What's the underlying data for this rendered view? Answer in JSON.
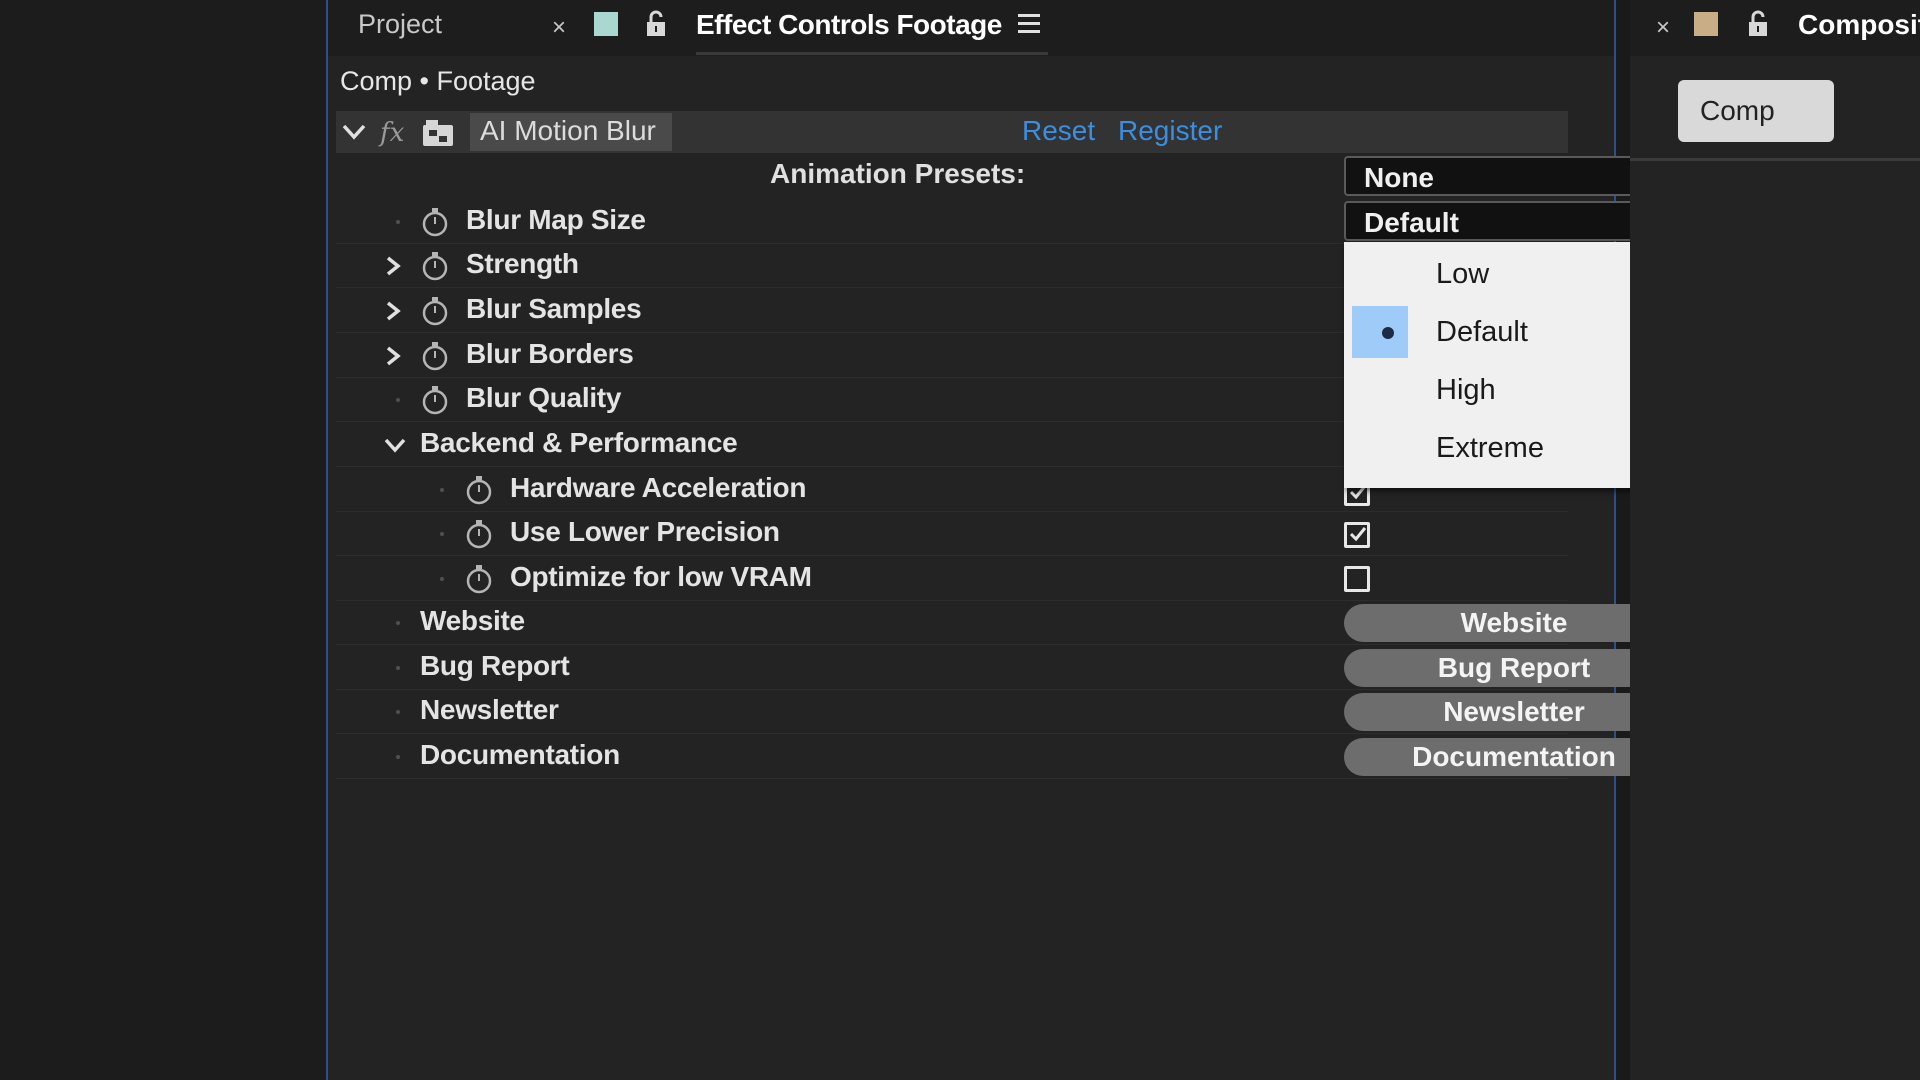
{
  "tabs": {
    "project": "Project",
    "close_symbol": "×",
    "effect_controls": "Effect Controls Footage",
    "right_title": "Composit"
  },
  "breadcrumb": "Comp • Footage",
  "effect": {
    "name": "AI Motion Blur",
    "reset": "Reset",
    "register": "Register",
    "presets_label": "Animation Presets:",
    "presets_value": "None"
  },
  "params": {
    "blur_map_size": "Blur Map Size",
    "blur_map_size_value": "Default",
    "strength": "Strength",
    "blur_samples": "Blur Samples",
    "blur_borders": "Blur Borders",
    "blur_quality": "Blur Quality",
    "backend": "Backend & Performance",
    "hardware_accel": "Hardware Acceleration",
    "lower_precision": "Use Lower Precision",
    "low_vram": "Optimize for low VRAM",
    "website": "Website",
    "bug_report": "Bug Report",
    "newsletter": "Newsletter",
    "documentation": "Documentation"
  },
  "buttons": {
    "website": "Website",
    "bug_report": "Bug Report",
    "newsletter": "Newsletter",
    "documentation": "Documentation"
  },
  "menu": {
    "items": [
      "Low",
      "Default",
      "High",
      "Extreme"
    ],
    "selected": "Default"
  },
  "checks": {
    "hardware_accel": true,
    "lower_precision": true,
    "low_vram": false
  },
  "right_panel": {
    "comp_button": "Comp"
  },
  "colors": {
    "link": "#3b8ee0",
    "panel_border": "#2e4f8a",
    "menu_selection": "#9ecbf7"
  },
  "icons": [
    "close-icon",
    "lock-icon",
    "hamburger-icon",
    "stopwatch-icon",
    "fx-icon",
    "chevron-right-icon",
    "chevron-down-icon",
    "cursor-icon"
  ]
}
